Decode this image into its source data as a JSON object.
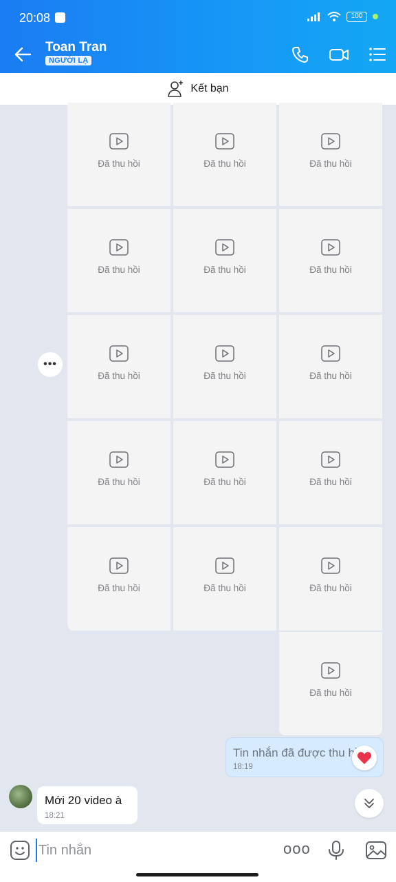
{
  "status": {
    "time": "20:08",
    "battery": "100"
  },
  "header": {
    "contact_name": "Toan Tran",
    "badge": "NGƯỜI LẠ",
    "icons": [
      "back-arrow-icon",
      "phone-icon",
      "video-call-icon",
      "menu-list-icon"
    ]
  },
  "add_friend": {
    "label": "Kết bạn"
  },
  "recalled_label": "Đã thu hồi",
  "recalled_videos": [
    {
      "label": "Đã thu hồi"
    },
    {
      "label": "Đã thu hồi"
    },
    {
      "label": "Đã thu hồi"
    },
    {
      "label": "Đã thu hồi"
    },
    {
      "label": "Đã thu hồi"
    },
    {
      "label": "Đã thu hồi"
    },
    {
      "label": "Đã thu hồi"
    },
    {
      "label": "Đã thu hồi"
    },
    {
      "label": "Đã thu hồi"
    },
    {
      "label": "Đã thu hồi"
    },
    {
      "label": "Đã thu hồi"
    },
    {
      "label": "Đã thu hồi"
    },
    {
      "label": "Đã thu hồi"
    },
    {
      "label": "Đã thu hồi"
    },
    {
      "label": "Đã thu hồi"
    },
    {
      "label": "Đã thu hồi"
    }
  ],
  "my_message": {
    "text": "Tin nhắn đã được thu hồi",
    "time": "18:19",
    "reaction": "heart"
  },
  "their_message": {
    "text": "Mới 20 video à",
    "time": "18:21"
  },
  "composer": {
    "placeholder": "Tin nhắn",
    "more": "ooo"
  },
  "colors": {
    "header_start": "#1b7cf3",
    "header_end": "#14a7f4",
    "my_bubble": "#d6ebff",
    "bg": "#e2e7ef"
  }
}
